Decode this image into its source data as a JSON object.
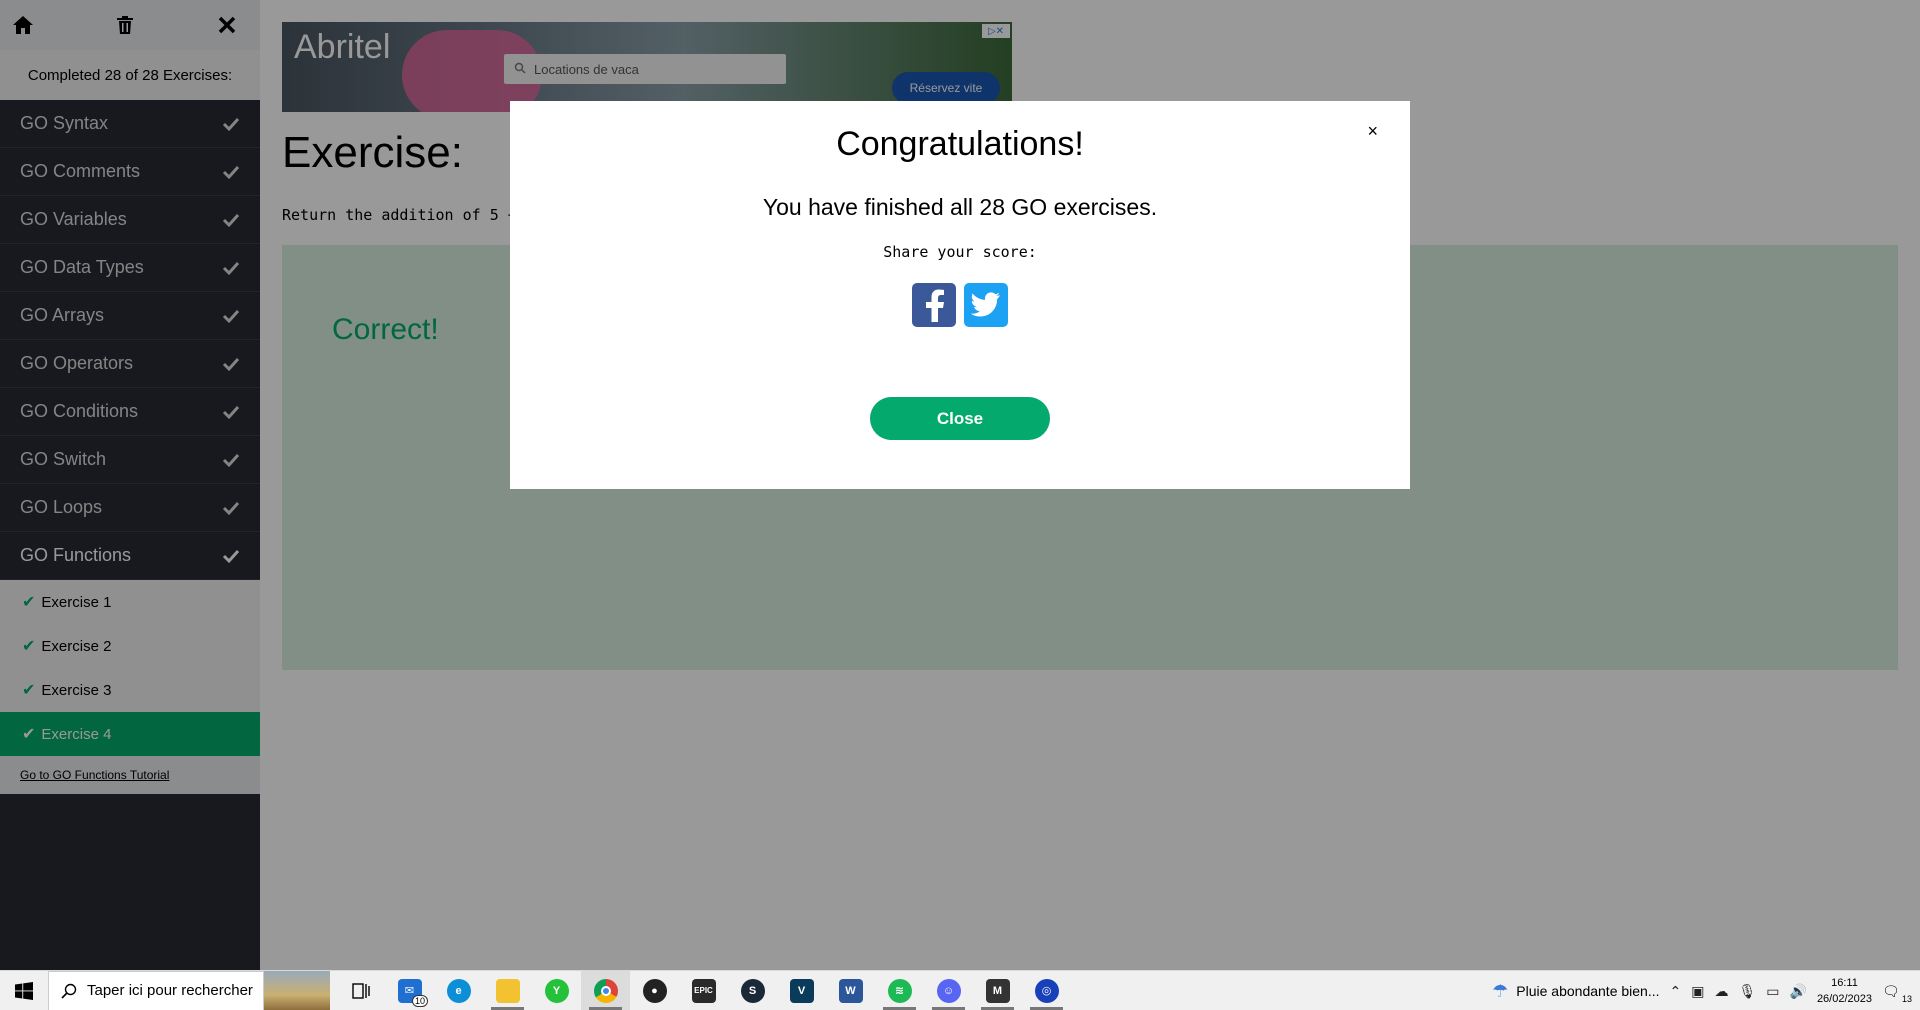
{
  "sidebar": {
    "completed_text": "Completed 28 of 28 Exercises:",
    "chapters": [
      {
        "label": "GO Syntax"
      },
      {
        "label": "GO Comments"
      },
      {
        "label": "GO Variables"
      },
      {
        "label": "GO Data Types"
      },
      {
        "label": "GO Arrays"
      },
      {
        "label": "GO Operators"
      },
      {
        "label": "GO Conditions"
      },
      {
        "label": "GO Switch"
      },
      {
        "label": "GO Loops"
      },
      {
        "label": "GO Functions"
      }
    ],
    "exercises": [
      {
        "label": "Exercise 1"
      },
      {
        "label": "Exercise 2"
      },
      {
        "label": "Exercise 3"
      },
      {
        "label": "Exercise 4"
      }
    ],
    "tutorial_link": "Go to GO Functions Tutorial"
  },
  "ad": {
    "brand": "Abritel",
    "search_placeholder": "Locations de vaca",
    "button_label": "Réservez vite"
  },
  "main": {
    "title": "Exercise:",
    "instruction": "Return the addition of 5 + x.",
    "result": "Correct!"
  },
  "modal": {
    "title": "Congratulations!",
    "message": "You have finished all 28 GO exercises.",
    "share_label": "Share your score:",
    "close_x": "×",
    "close_button": "Close"
  },
  "taskbar": {
    "search_placeholder": "Taper ici pour rechercher",
    "mail_badge": "10",
    "weather_text": "Pluie abondante bien...",
    "time": "16:11",
    "date": "26/02/2023",
    "notification_count": "13"
  },
  "colors": {
    "accent": "#04aa6d",
    "sidebar_bg": "#282a35",
    "result_bg": "#d9eee1",
    "facebook": "#3b5998",
    "twitter": "#1da1f2"
  }
}
